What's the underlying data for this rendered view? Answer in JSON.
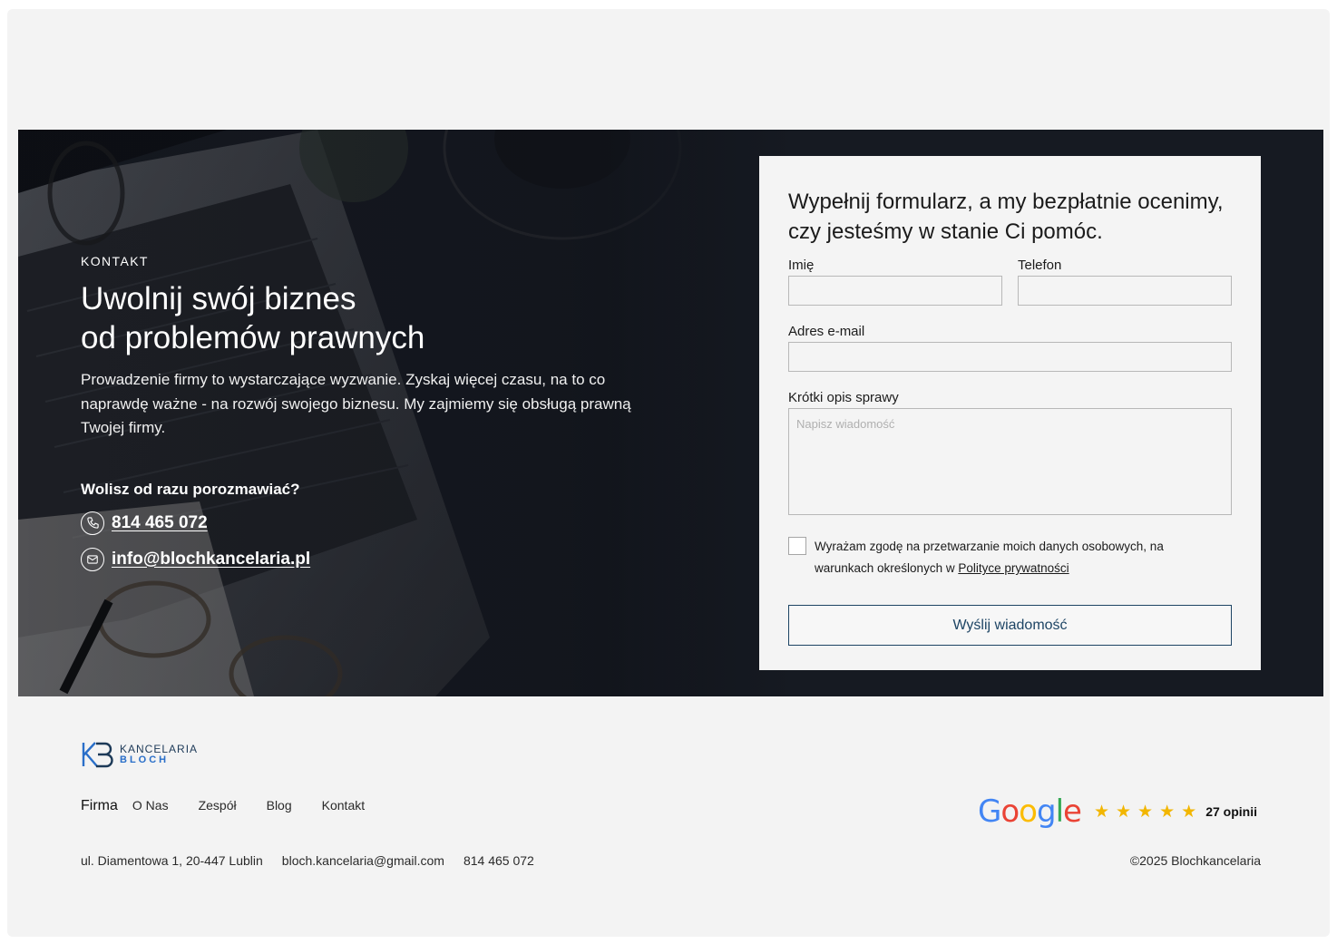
{
  "hero": {
    "eyebrow": "KONTAKT",
    "title_line1": "Uwolnij swój biznes",
    "title_line2": "od problemów prawnych",
    "description": "Prowadzenie firmy to wystarczające wyzwanie. Zyskaj więcej czasu, na to co naprawdę ważne - na rozwój swojego biznesu. My zajmiemy się obsługą prawną Twojej firmy.",
    "call_title": "Wolisz od razu porozmawiać?",
    "phone": "814 465 072",
    "email": "info@blochkancelaria.pl"
  },
  "form": {
    "title": "Wypełnij formularz, a my bezpłatnie ocenimy, czy jesteśmy w stanie Ci pomóc.",
    "name_label": "Imię",
    "phone_label": "Telefon",
    "email_label": "Adres e-mail",
    "message_label": "Krótki opis sprawy",
    "message_placeholder": "Napisz wiadomość",
    "consent_text": "Wyrażam zgodę na przetwarzanie moich danych osobowych, na warunkach określonych w ",
    "consent_link": "Polityce prywatności",
    "submit_label": "Wyślij wiadomość"
  },
  "footer": {
    "logo_line1": "KANCELARIA",
    "logo_line2": "BLOCH",
    "nav_heading": "Firma",
    "nav": [
      "O Nas",
      "Zespół",
      "Blog",
      "Kontakt"
    ],
    "address": "ul. Diamentowa 1, 20-447 Lublin",
    "email": "bloch.kancelaria@gmail.com",
    "phone": "814 465 072",
    "google_word": "Google",
    "rating_stars": 5,
    "reviews_count": "27 opinii",
    "copyright": "©2025 Blochkancelaria"
  },
  "colors": {
    "accent": "#1d4464",
    "brand_blue": "#2a6fc9",
    "star": "#f2b600"
  }
}
